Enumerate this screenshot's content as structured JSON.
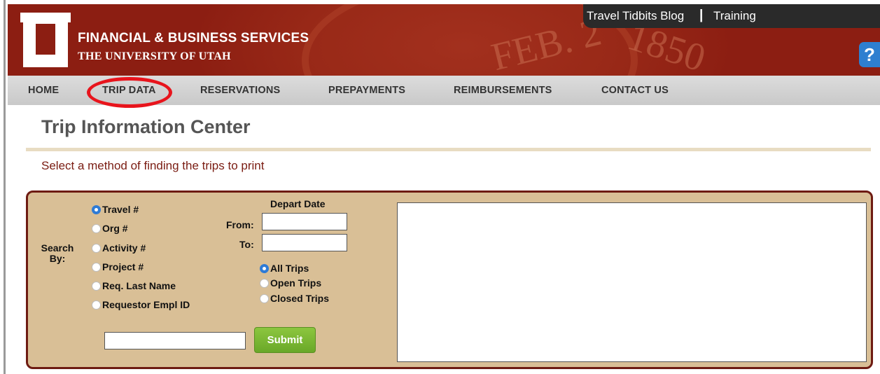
{
  "header": {
    "org_title": "FINANCIAL & BUSINESS SERVICES",
    "org_subtitle": "THE UNIVERSITY OF UTAH",
    "top_links": [
      "Travel Tidbits Blog",
      "Training"
    ],
    "separator": "|",
    "help_label": "?",
    "seal_text_1": "FEB. 2",
    "seal_text_2": "1850"
  },
  "nav": {
    "items": [
      "HOME",
      "TRIP DATA",
      "RESERVATIONS",
      "PREPAYMENTS",
      "REIMBURSEMENTS",
      "CONTACT US"
    ],
    "highlighted": "TRIP DATA"
  },
  "page": {
    "title": "Trip Information Center",
    "instruction": "Select a method of finding the trips to print"
  },
  "search": {
    "search_by_label_1": "Search",
    "search_by_label_2": "By:",
    "options": [
      "Travel #",
      "Org #",
      "Activity #",
      "Project #",
      "Req. Last Name",
      "Requestor Empl ID"
    ],
    "selected_option": "Travel #",
    "search_value": "",
    "submit_label": "Submit"
  },
  "depart_date": {
    "label": "Depart Date",
    "from_label": "From:",
    "to_label": "To:",
    "from_value": "",
    "to_value": "",
    "trip_filters": [
      "All Trips",
      "Open Trips",
      "Closed Trips"
    ],
    "selected_filter": "All Trips"
  },
  "colors": {
    "header_bg": "#8c1e12",
    "panel_bg": "#d9bf96",
    "panel_border": "#6e1b12",
    "accent_red_circle": "#e8141c",
    "submit_green": "#7ab534",
    "radio_selected": "#2e7bd6",
    "instruction_text": "#7a1c12"
  }
}
